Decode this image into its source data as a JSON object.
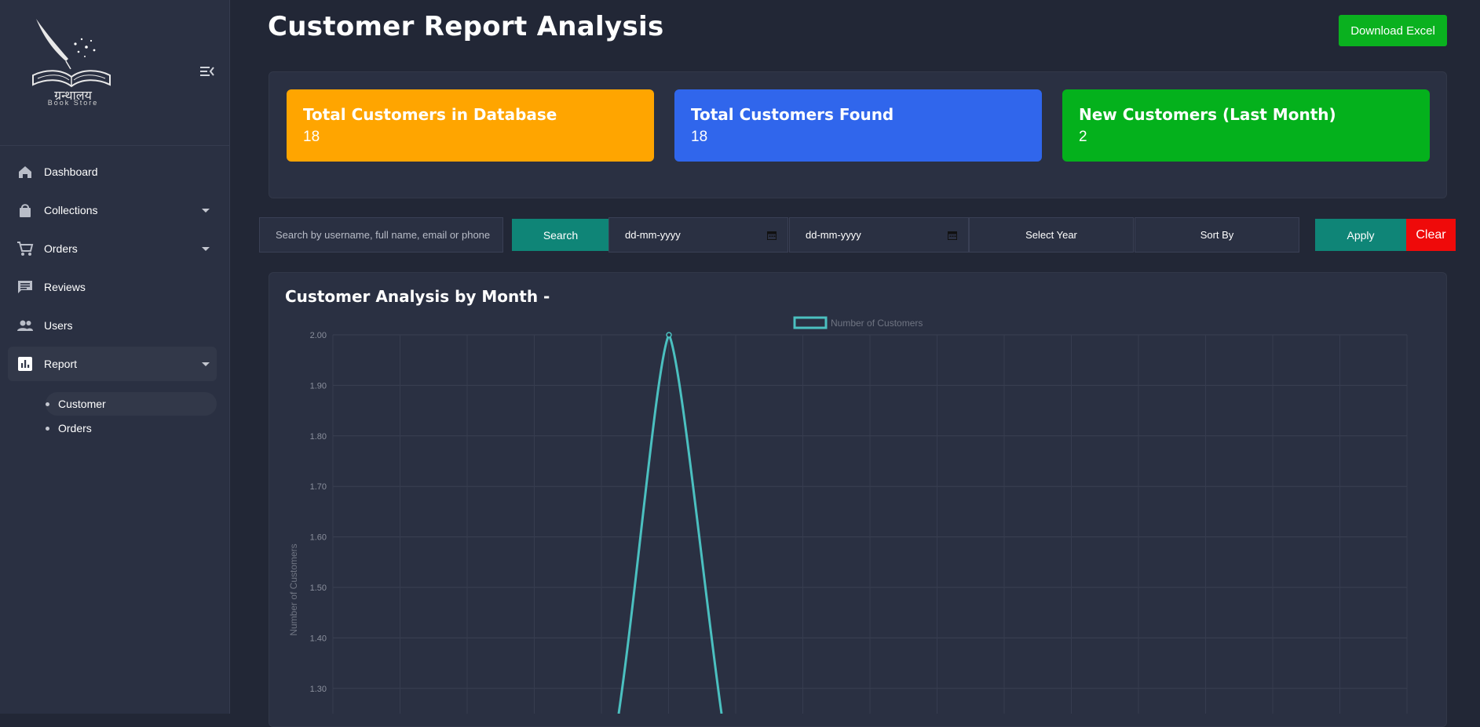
{
  "sidebar": {
    "logo_title": "ग्रन्थालय",
    "logo_subtitle": "Book Store",
    "items": [
      {
        "label": "Dashboard",
        "icon": "home-icon"
      },
      {
        "label": "Collections",
        "icon": "shopping-bag-icon"
      },
      {
        "label": "Orders",
        "icon": "cart-icon"
      },
      {
        "label": "Reviews",
        "icon": "comment-icon"
      },
      {
        "label": "Users",
        "icon": "people-icon"
      },
      {
        "label": "Report",
        "icon": "bar-chart-icon"
      }
    ],
    "report_subitems": [
      {
        "label": "Customer"
      },
      {
        "label": "Orders"
      }
    ]
  },
  "header": {
    "title": "Customer Report Analysis",
    "download_label": "Download Excel"
  },
  "stats": [
    {
      "label": "Total Customers in Database",
      "value": "18",
      "color": "#ffa500"
    },
    {
      "label": "Total Customers Found",
      "value": "18",
      "color": "#3066ec"
    },
    {
      "label": "New Customers (Last Month)",
      "value": "2",
      "color": "#04b11c"
    }
  ],
  "filters": {
    "search_placeholder": "Search by username, full name, email or phone",
    "search_button": "Search",
    "start_date_placeholder": "dd-mm-yyyy",
    "end_date_placeholder": "dd-mm-yyyy",
    "year_select": "Select Year",
    "sort_select": "Sort By",
    "apply_button": "Apply",
    "clear_button": "Clear"
  },
  "chart_title": "Customer Analysis by Month -",
  "chart_data": {
    "type": "line",
    "legend": [
      "Number of Customers"
    ],
    "legend_position": "top",
    "ylabel": "Number of Customers",
    "yticks": [
      "2.00",
      "1.90",
      "1.80",
      "1.70",
      "1.60",
      "1.50",
      "1.40",
      "1.30"
    ],
    "ylim_visible": [
      1.25,
      2.0
    ],
    "grid": true,
    "series": [
      {
        "name": "Number of Customers",
        "peak_value": 2,
        "color": "#4bc0c0"
      }
    ]
  },
  "colors": {
    "accent_teal": "#0f8577",
    "download_green": "#0ab11f",
    "clear_red": "#ef0a0a",
    "line_color": "#4bc0c0"
  }
}
